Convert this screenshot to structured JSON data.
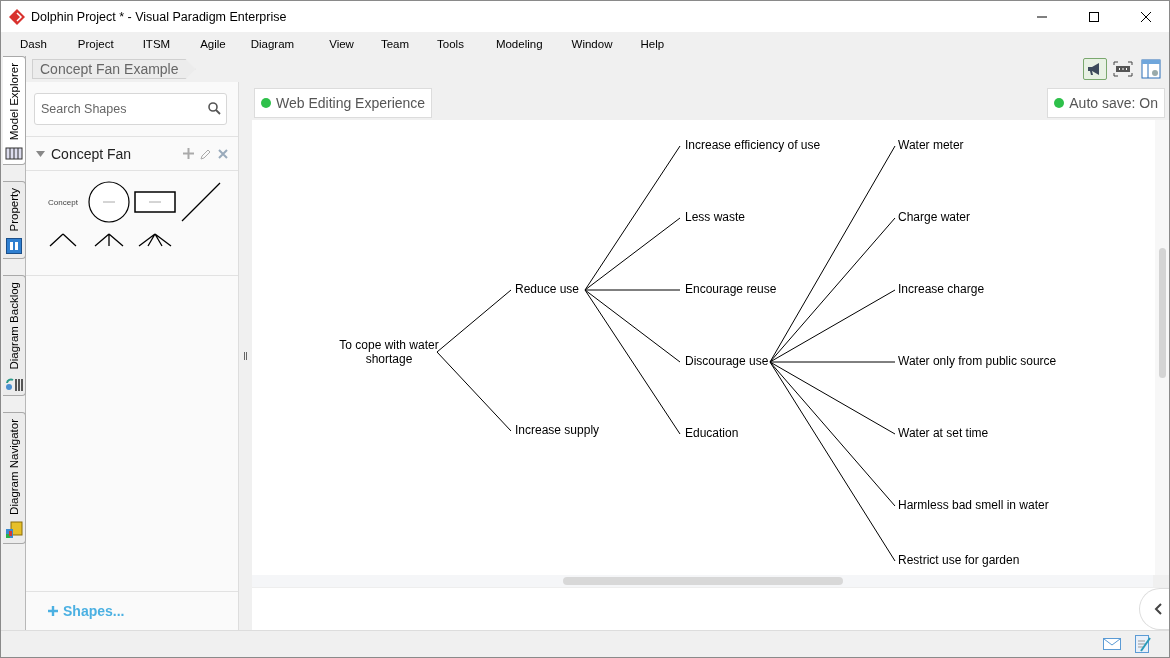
{
  "window": {
    "title": "Dolphin Project * - Visual Paradigm Enterprise"
  },
  "menu": [
    "Dash",
    "Project",
    "ITSM",
    "Agile",
    "Diagram",
    "View",
    "Team",
    "Tools",
    "Modeling",
    "Window",
    "Help"
  ],
  "side_tabs": [
    {
      "label": "Model Explorer",
      "selected": true,
      "kind": "explorer"
    },
    {
      "label": "Property",
      "selected": false,
      "kind": "property"
    },
    {
      "label": "Diagram Backlog",
      "selected": false,
      "kind": "backlog"
    },
    {
      "label": "Diagram Navigator",
      "selected": false,
      "kind": "navigator"
    }
  ],
  "breadcrumb": "Concept Fan Example",
  "search": {
    "placeholder": "Search Shapes"
  },
  "shape_group": {
    "title": "Concept Fan",
    "expanded": true,
    "palette": [
      {
        "kind": "text",
        "label": "Concept"
      },
      {
        "kind": "circle"
      },
      {
        "kind": "rect"
      },
      {
        "kind": "line"
      },
      {
        "kind": "fan2"
      },
      {
        "kind": "fan3"
      },
      {
        "kind": "fan4"
      }
    ]
  },
  "shapes_link": "Shapes...",
  "web_editing": {
    "label": "Web Editing Experience",
    "on": true
  },
  "auto_save": {
    "label": "Auto save: On",
    "on": true
  },
  "diagram": {
    "root": {
      "text": "To cope with water shortage",
      "children": [
        {
          "text": "Reduce use",
          "children": [
            {
              "text": "Increase efficiency of use"
            },
            {
              "text": "Less waste"
            },
            {
              "text": "Encourage reuse"
            },
            {
              "text": "Discourage use",
              "children": [
                {
                  "text": "Water meter"
                },
                {
                  "text": "Charge water"
                },
                {
                  "text": "Increase charge"
                },
                {
                  "text": "Water only from public source"
                },
                {
                  "text": "Water at set time"
                },
                {
                  "text": "Harmless bad smell in water"
                },
                {
                  "text": "Restrict use for garden"
                }
              ]
            },
            {
              "text": "Education"
            }
          ]
        },
        {
          "text": "Increase supply"
        }
      ]
    }
  }
}
